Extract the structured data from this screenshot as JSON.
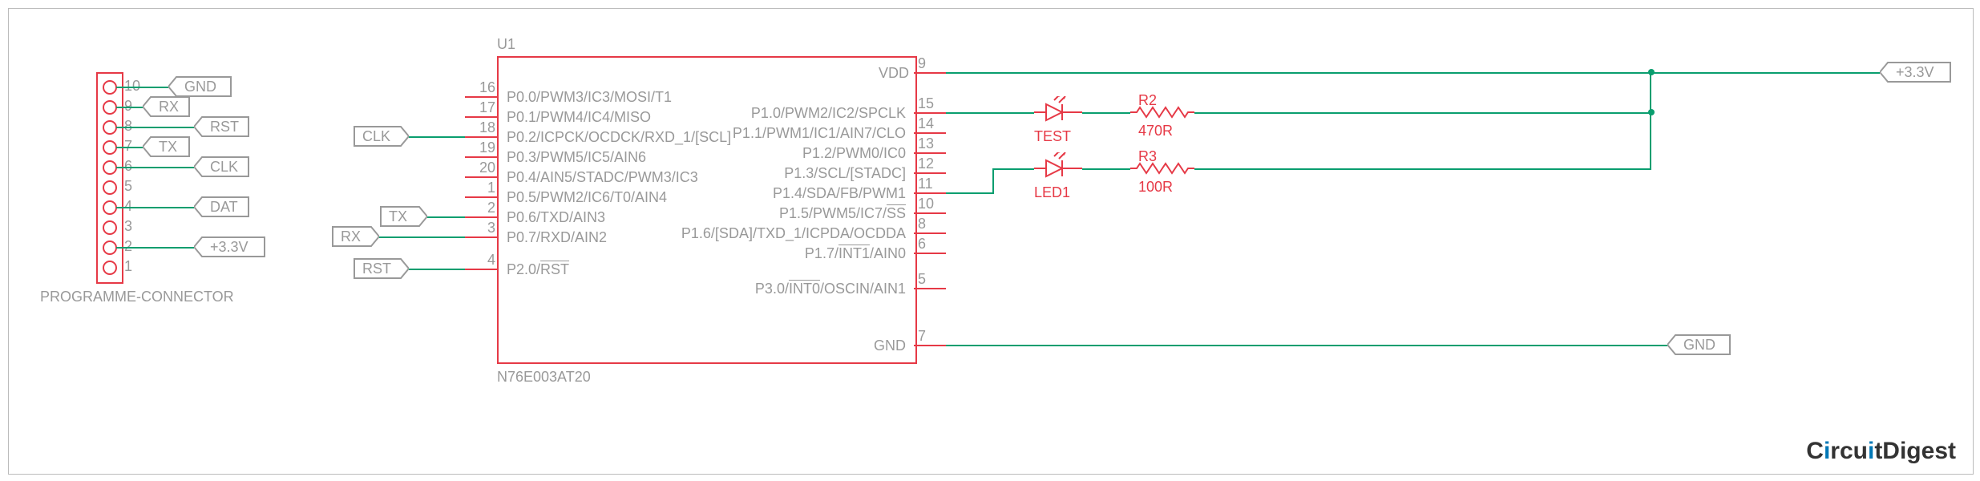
{
  "chip": {
    "ref": "U1",
    "part": "N76E003AT20",
    "left_pins": [
      {
        "num": "16",
        "name": "P0.0/PWM3/IC3/MOSI/T1"
      },
      {
        "num": "17",
        "name": "P0.1/PWM4/IC4/MISO"
      },
      {
        "num": "18",
        "name": "P0.2/ICPCK/OCDCK/RXD_1/[SCL]"
      },
      {
        "num": "19",
        "name": "P0.3/PWM5/IC5/AIN6"
      },
      {
        "num": "20",
        "name": "P0.4/AIN5/STADC/PWM3/IC3"
      },
      {
        "num": "1",
        "name": "P0.5/PWM2/IC6/T0/AIN4"
      },
      {
        "num": "2",
        "name": "P0.6/TXD/AIN3"
      },
      {
        "num": "3",
        "name": "P0.7/RXD/AIN2"
      },
      {
        "num": "4",
        "name": "P2.0/RST",
        "overline": "RST"
      }
    ],
    "right_pins": [
      {
        "num": "9",
        "name": "VDD"
      },
      {
        "num": "15",
        "name": "P1.0/PWM2/IC2/SPCLK"
      },
      {
        "num": "14",
        "name": "P1.1/PWM1/IC1/AIN7/CLO"
      },
      {
        "num": "13",
        "name": "P1.2/PWM0/IC0"
      },
      {
        "num": "12",
        "name": "P1.3/SCL/[STADC]"
      },
      {
        "num": "11",
        "name": "P1.4/SDA/FB/PWM1"
      },
      {
        "num": "10",
        "name": "P1.5/PWM5/IC7/SS",
        "overline": "SS"
      },
      {
        "num": "8",
        "name": "P1.6/[SDA]/TXD_1/ICPDA/OCDDA"
      },
      {
        "num": "6",
        "name": "P1.7/INT1/AIN0",
        "overline": "INT1"
      },
      {
        "num": "5",
        "name": "P3.0/INT0/OSCIN/AIN1",
        "overline": "INT0"
      },
      {
        "num": "7",
        "name": "GND"
      }
    ]
  },
  "connector": {
    "label": "PROGRAMME-CONNECTOR",
    "pins": [
      "10",
      "9",
      "8",
      "7",
      "6",
      "5",
      "4",
      "3",
      "2",
      "1"
    ],
    "nets": [
      {
        "from": "10",
        "tag": "GND"
      },
      {
        "from": "9",
        "tag": "RX"
      },
      {
        "from": "8",
        "tag": "RST"
      },
      {
        "from": "7",
        "tag": "TX"
      },
      {
        "from": "6",
        "tag": "CLK"
      },
      {
        "from": "4",
        "tag": "DAT"
      },
      {
        "from": "2",
        "tag": "+3.3V"
      }
    ]
  },
  "chip_input_nets": [
    {
      "tag": "CLK",
      "to_pin": "18"
    },
    {
      "tag": "TX",
      "to_pin": "2"
    },
    {
      "tag": "RX",
      "to_pin": "3"
    },
    {
      "tag": "RST",
      "to_pin": "4"
    }
  ],
  "components": {
    "leds": [
      {
        "ref": "TEST",
        "to_pin": "15"
      },
      {
        "ref": "LED1",
        "to_pin": "11"
      }
    ],
    "resistors": [
      {
        "ref": "R2",
        "value": "470R"
      },
      {
        "ref": "R3",
        "value": "100R"
      }
    ]
  },
  "power_nets": {
    "vdd": "+3.3V",
    "gnd": "GND"
  },
  "brand": "CircuitDigest"
}
